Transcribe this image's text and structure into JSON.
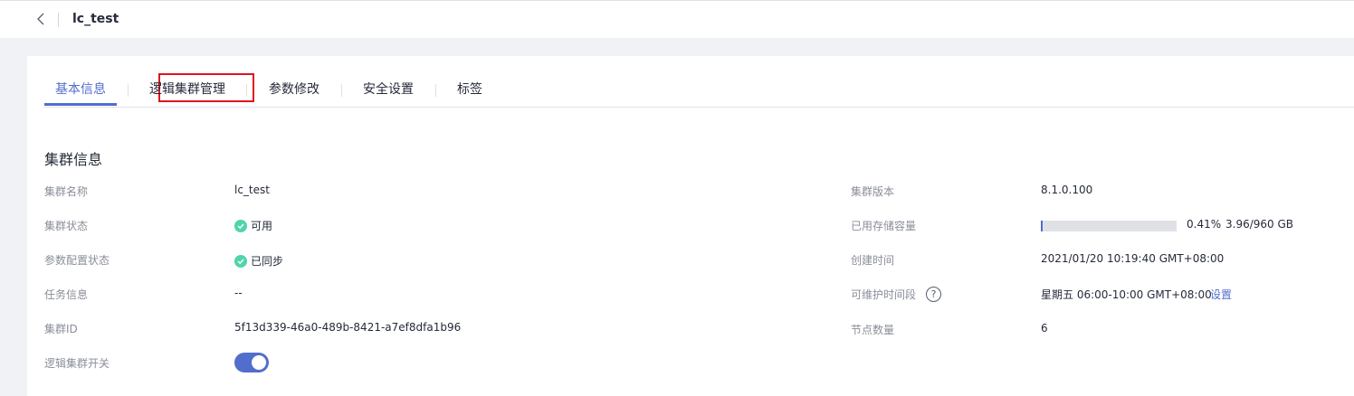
{
  "header": {
    "title": "lc_test"
  },
  "tabs": [
    {
      "label": "基本信息",
      "active": true
    },
    {
      "label": "逻辑集群管理",
      "active": false,
      "highlighted": true
    },
    {
      "label": "参数修改",
      "active": false
    },
    {
      "label": "安全设置",
      "active": false
    },
    {
      "label": "标签",
      "active": false
    }
  ],
  "section": {
    "title": "集群信息"
  },
  "left_fields": [
    {
      "label": "集群名称",
      "value": "lc_test"
    },
    {
      "label": "集群状态",
      "value": "可用",
      "icon": "success-icon"
    },
    {
      "label": "参数配置状态",
      "value": "已同步",
      "icon": "success-icon"
    },
    {
      "label": "任务信息",
      "value": "--"
    },
    {
      "label": "集群ID",
      "value": "5f13d339-46a0-489b-8421-a7ef8dfa1b96"
    },
    {
      "label": "逻辑集群开关",
      "toggle_on": true
    }
  ],
  "right_fields": [
    {
      "label": "集群版本",
      "value": "8.1.0.100"
    },
    {
      "label": "已用存储容量",
      "percent": "0.41%",
      "capacity": "3.96/960 GB",
      "usage_fraction": 0.0041
    },
    {
      "label": "创建时间",
      "value": "2021/01/20 10:19:40 GMT+08:00"
    },
    {
      "label": "可维护时间段",
      "value": "星期五 06:00-10:00 GMT+08:00",
      "action": "设置",
      "icon": "help-icon"
    },
    {
      "label": "节点数量",
      "value": "6"
    }
  ],
  "colors": {
    "accent": "#526ecc",
    "success": "#50d4ab",
    "highlight": "#e1141e"
  }
}
